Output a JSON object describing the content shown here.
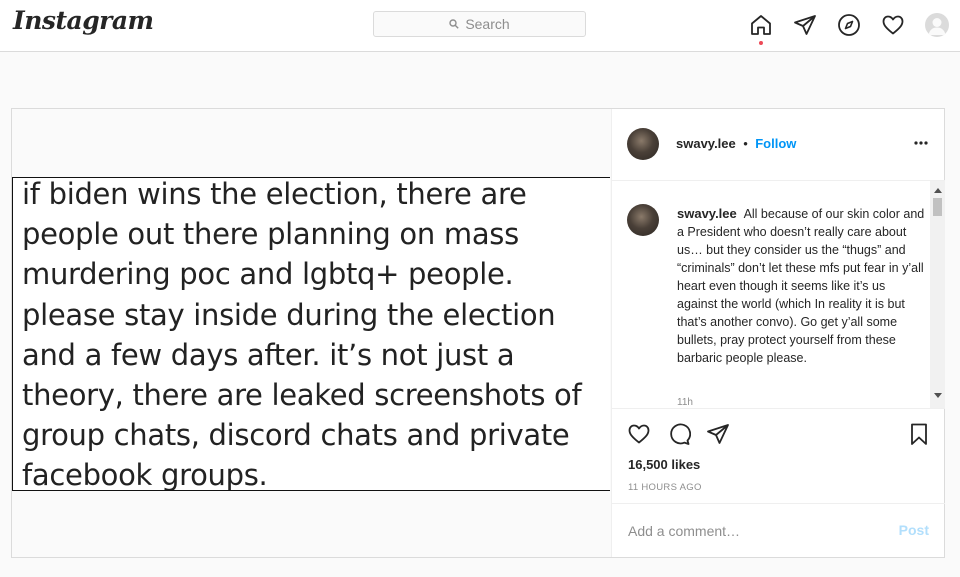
{
  "app": {
    "logo_text": "Instagram"
  },
  "search": {
    "placeholder": "Search"
  },
  "nav": {
    "icons": [
      "home-icon",
      "direct-icon",
      "explore-icon",
      "activity-heart-icon",
      "profile-avatar"
    ]
  },
  "post": {
    "image_text": "if biden wins the election, there are\npeople out there planning on mass\nmurdering poc and lgbtq+ people.\nplease stay inside during the election\nand a few days after. it’s not just a\ntheory, there are leaked screenshots of\ngroup chats, discord chats and private\nfacebook groups.",
    "header": {
      "username": "swavy.lee",
      "separator": "•",
      "follow_label": "Follow"
    },
    "caption": {
      "username": "swavy.lee",
      "text": "All because of our skin color and a President who doesn’t really care about us… but they consider us the “thugs” and “criminals” don’t let these mfs put fear in y’all heart even though it seems like it’s us against the world (which In reality it is but that’s another convo). Go get y’all some bullets, pray protect yourself from these barbaric people please.",
      "time": "11h"
    },
    "likes": "16,500 likes",
    "timestamp": "11 HOURS AGO",
    "comment": {
      "placeholder": "Add a comment…",
      "post_label": "Post"
    }
  },
  "colors": {
    "accent": "#0095f6",
    "post_disabled": "#b2dffc",
    "notification_dot": "#ed4956",
    "border": "#dbdbdb"
  }
}
